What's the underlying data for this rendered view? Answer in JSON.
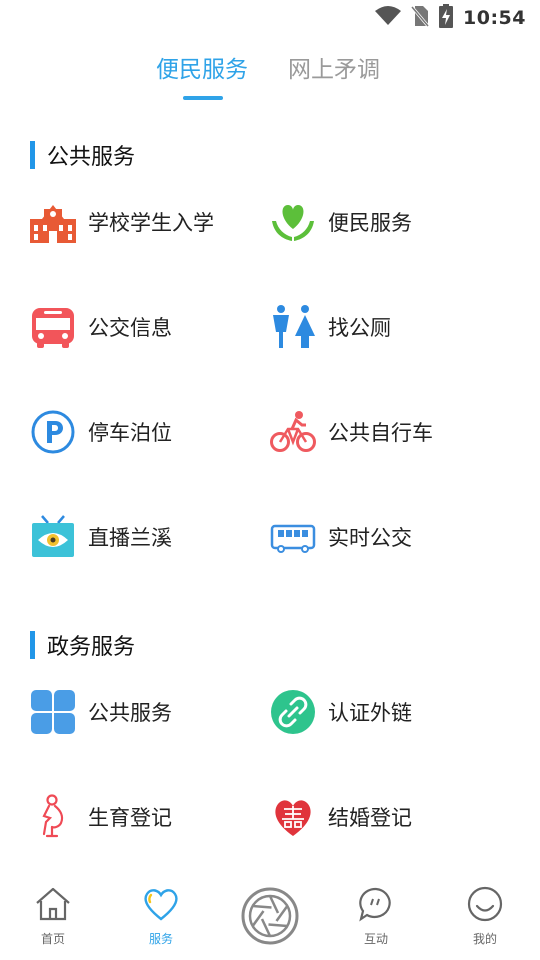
{
  "status_bar": {
    "time": "10:54",
    "icons": [
      "wifi-icon",
      "no-sim-icon",
      "battery-charging-icon"
    ]
  },
  "top_tabs": [
    {
      "label": "便民服务",
      "active": true
    },
    {
      "label": "网上矛调",
      "active": false
    }
  ],
  "sections": [
    {
      "title": "公共服务",
      "items": [
        {
          "label": "学校学生入学",
          "icon": "school-icon"
        },
        {
          "label": "便民服务",
          "icon": "heart-hands-icon"
        },
        {
          "label": "公交信息",
          "icon": "bus-icon"
        },
        {
          "label": "找公厕",
          "icon": "toilet-icon"
        },
        {
          "label": "停车泊位",
          "icon": "parking-icon"
        },
        {
          "label": "公共自行车",
          "icon": "bicycle-icon"
        },
        {
          "label": "直播兰溪",
          "icon": "tv-eye-icon"
        },
        {
          "label": "实时公交",
          "icon": "realtime-bus-icon"
        }
      ]
    },
    {
      "title": "政务服务",
      "items": [
        {
          "label": "公共服务",
          "icon": "clover-icon"
        },
        {
          "label": "认证外链",
          "icon": "link-icon"
        },
        {
          "label": "生育登记",
          "icon": "pregnant-icon"
        },
        {
          "label": "结婚登记",
          "icon": "double-happiness-icon"
        }
      ]
    }
  ],
  "bottom_nav": [
    {
      "label": "首页",
      "icon": "home-icon",
      "active": false
    },
    {
      "label": "服务",
      "icon": "heart-icon",
      "active": true
    },
    {
      "label": "",
      "icon": "camera-aperture-icon",
      "active": false
    },
    {
      "label": "互动",
      "icon": "chat-bubble-icon",
      "active": false
    },
    {
      "label": "我的",
      "icon": "smiley-icon",
      "active": false
    }
  ],
  "colors": {
    "accent": "#2fa3e8",
    "section_bar": "#2196e8"
  }
}
